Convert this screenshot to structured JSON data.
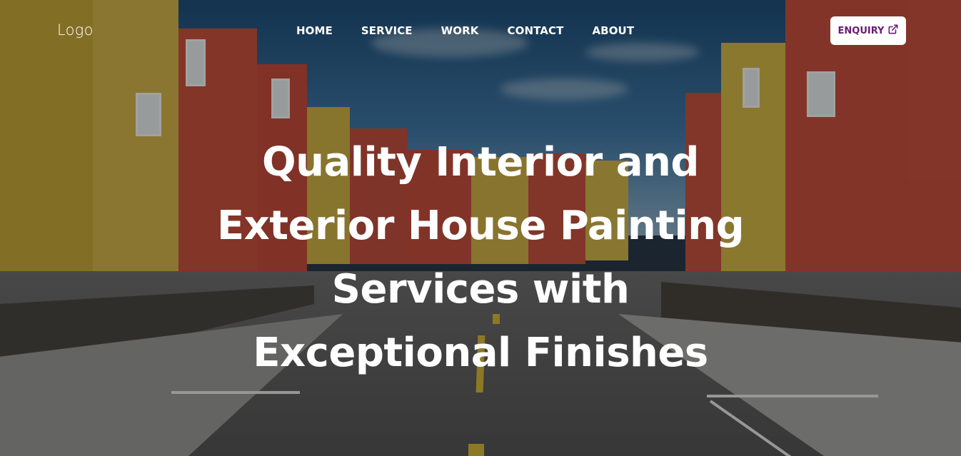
{
  "brand": {
    "logo_text": "Logo"
  },
  "nav": {
    "items": [
      {
        "label": "HOME"
      },
      {
        "label": "SERVICE"
      },
      {
        "label": "WORK"
      },
      {
        "label": "CONTACT"
      },
      {
        "label": "ABOUT"
      }
    ],
    "enquiry_label": "ENQUIRY",
    "enquiry_icon": "external-link-icon"
  },
  "hero": {
    "headline_lines": [
      "Quality Interior and",
      "Exterior House Painting",
      "Services with",
      "Exceptional Finishes"
    ],
    "background_image": "colorful-street-houses"
  },
  "colors": {
    "accent": "#6a1a73",
    "text": "#ffffff",
    "button_bg": "#ffffff"
  }
}
